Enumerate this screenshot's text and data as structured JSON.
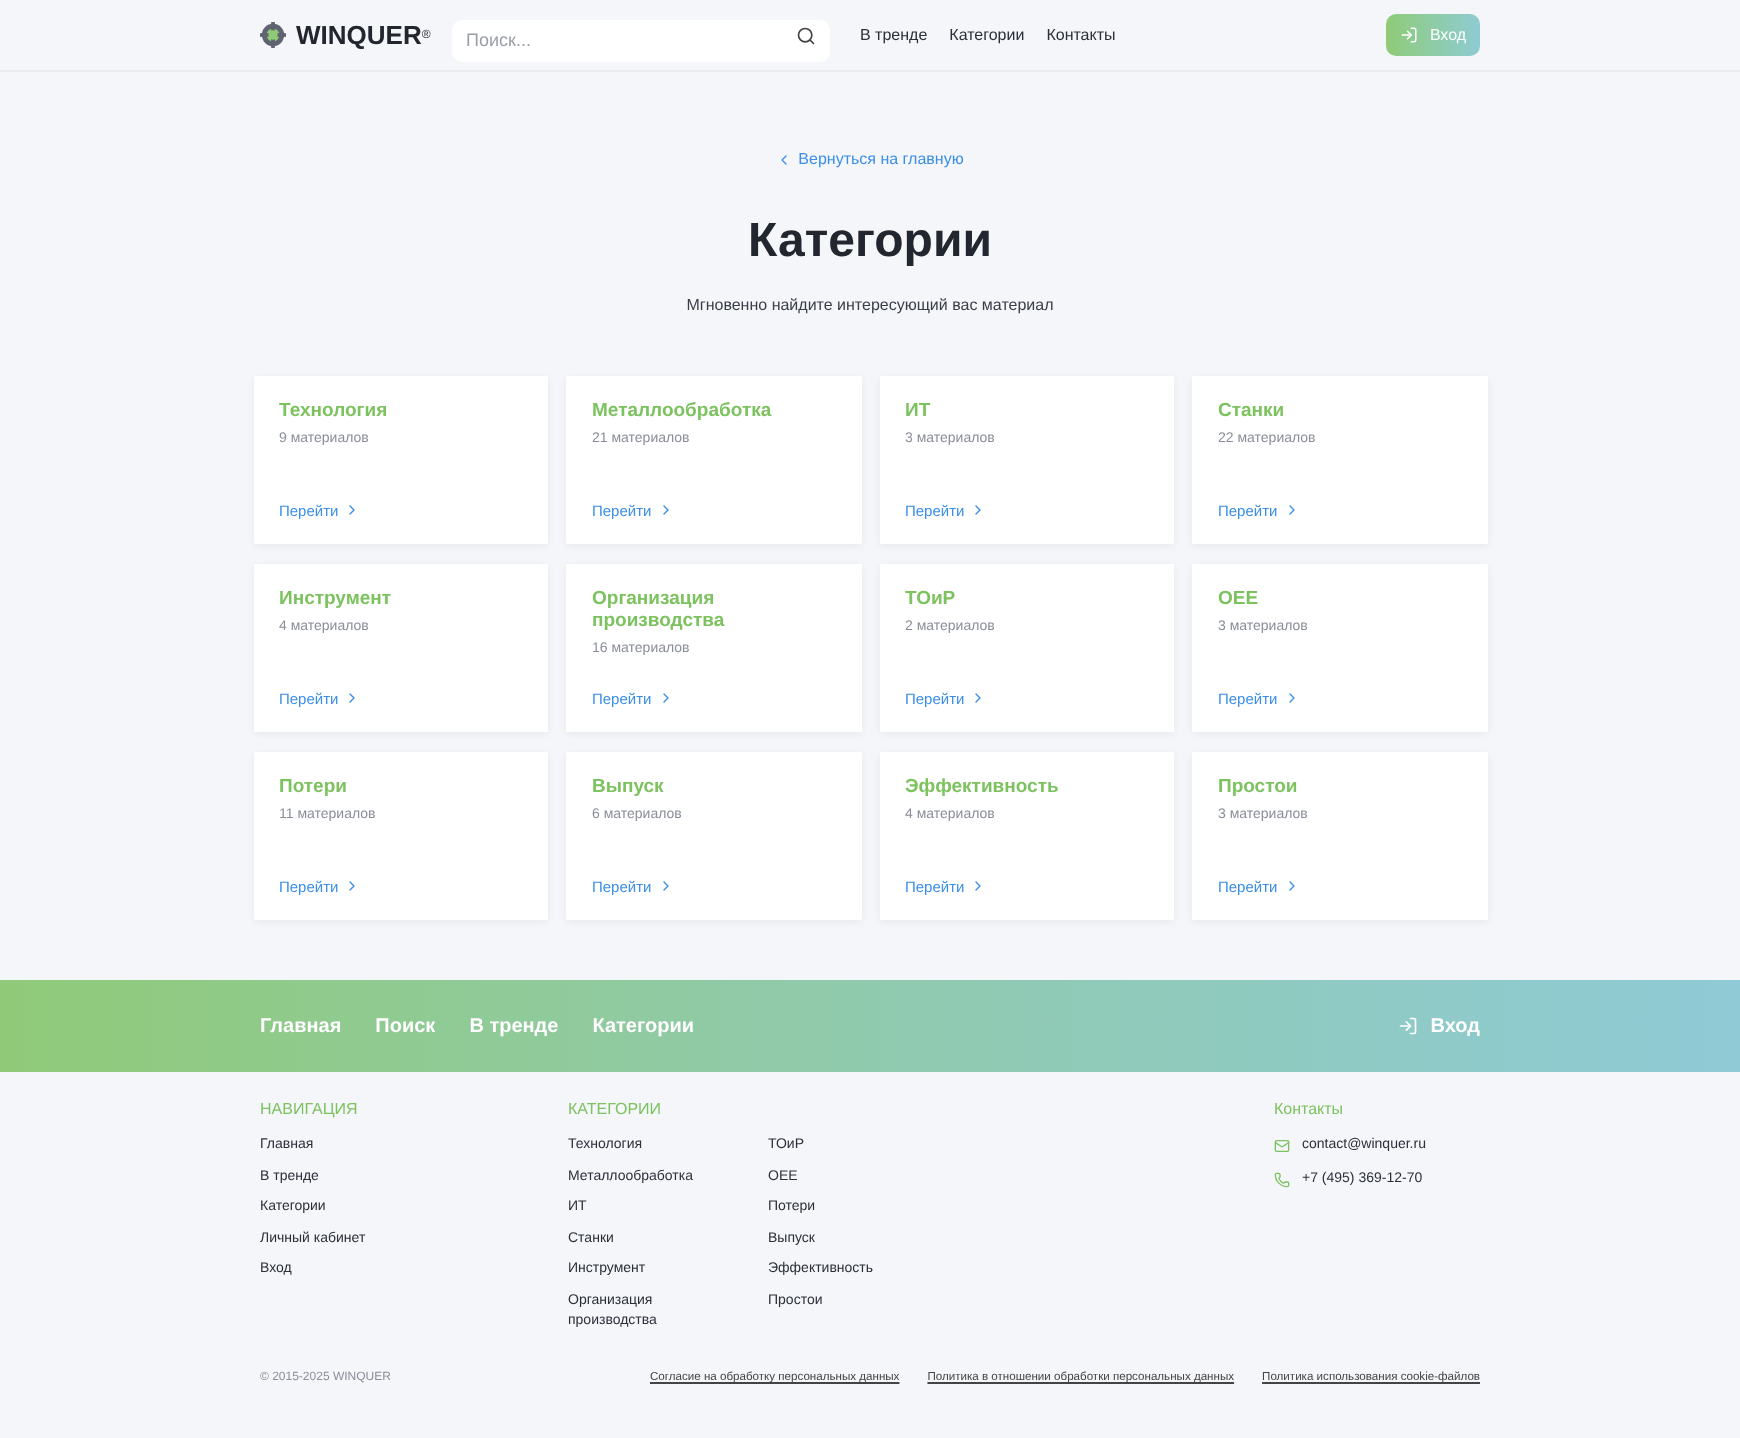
{
  "header": {
    "logo": "WINQUER",
    "logo_mark": "®",
    "search": {
      "placeholder": "Поиск..."
    },
    "nav": [
      "В тренде",
      "Категории",
      "Контакты"
    ],
    "login": "Вход"
  },
  "back_link": "Вернуться на главную",
  "title": "Категории",
  "subtitle": "Мгновенно найдите интересующий вас материал",
  "categories": [
    {
      "name": "Технология",
      "count": "9 материалов",
      "link": "Перейти"
    },
    {
      "name": "Металлообработка",
      "count": "21 материалов",
      "link": "Перейти"
    },
    {
      "name": "ИТ",
      "count": "3 материалов",
      "link": "Перейти"
    },
    {
      "name": "Станки",
      "count": "22 материалов",
      "link": "Перейти"
    },
    {
      "name": "Инструмент",
      "count": "4 материалов",
      "link": "Перейти"
    },
    {
      "name": "Организация производства",
      "count": "16 материалов",
      "link": "Перейти"
    },
    {
      "name": "ТОиР",
      "count": "2 материалов",
      "link": "Перейти"
    },
    {
      "name": "OEE",
      "count": "3 материалов",
      "link": "Перейти"
    },
    {
      "name": "Потери",
      "count": "11 материалов",
      "link": "Перейти"
    },
    {
      "name": "Выпуск",
      "count": "6 материалов",
      "link": "Перейти"
    },
    {
      "name": "Эффективность",
      "count": "4 материалов",
      "link": "Перейти"
    },
    {
      "name": "Простои",
      "count": "3 материалов",
      "link": "Перейти"
    }
  ],
  "footer_bar": {
    "links": [
      "Главная",
      "Поиск",
      "В тренде",
      "Категории"
    ],
    "login": "Вход"
  },
  "footer": {
    "nav_title": "НАВИГАЦИЯ",
    "nav": [
      "Главная",
      "В тренде",
      "Категории",
      "Личный кабинет",
      "Вход"
    ],
    "cat_title": "КАТЕГОРИИ",
    "cat_col_1": [
      "Технология",
      "Металлообработка",
      "ИТ",
      "Станки",
      "Инструмент",
      "Организация производства"
    ],
    "cat_col_2": [
      "ТОиР",
      "OEE",
      "Потери",
      "Выпуск",
      "Эффективность",
      "Простои"
    ],
    "contacts_title": "Контакты",
    "email": "contact@winquer.ru",
    "phone": "+7 (495) 369-12-70",
    "copyright": "© 2015-2025 WINQUER",
    "legal": [
      "Согласие на обработку персональных данных",
      "Политика в отношении обработки персональных данных",
      "Политика использования cookie-файлов"
    ]
  }
}
